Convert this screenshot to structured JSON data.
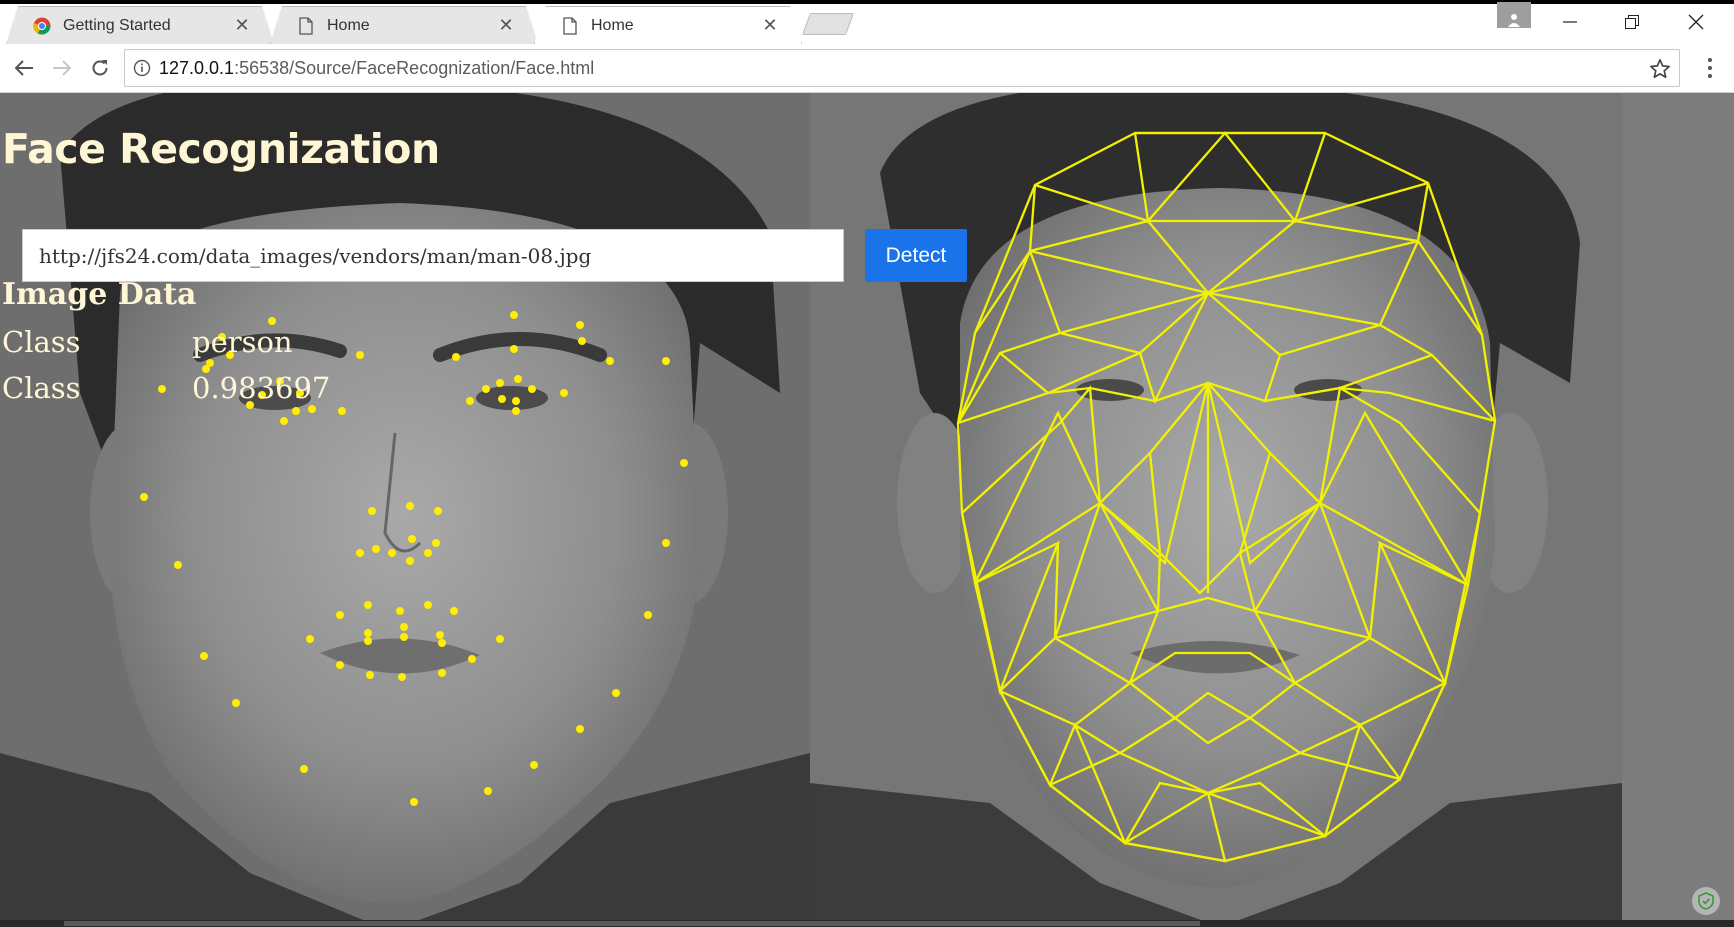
{
  "browser": {
    "tabs": [
      {
        "title": "Getting Started",
        "icon": "chrome-icon",
        "active": false
      },
      {
        "title": "Home",
        "icon": "page-icon",
        "active": false
      },
      {
        "title": "Home",
        "icon": "page-icon",
        "active": true
      }
    ],
    "url_host": "127.0.0.1",
    "url_rest": ":56538/Source/FaceRecognization/Face.html"
  },
  "page": {
    "title": "Face Recognization",
    "image_url_input_value": "http://jfs24.com/data_images/vendors/man/man-08.jpg",
    "detect_label": "Detect",
    "section_heading": "Image Data",
    "rows": [
      {
        "key": "Class",
        "value": "person"
      },
      {
        "key": "Class",
        "value": "0.983697"
      }
    ]
  },
  "colors": {
    "landmark": "#ffee00",
    "mesh": "#f2f200",
    "accent": "#1a73e8",
    "title_text": "#fff6d6"
  }
}
